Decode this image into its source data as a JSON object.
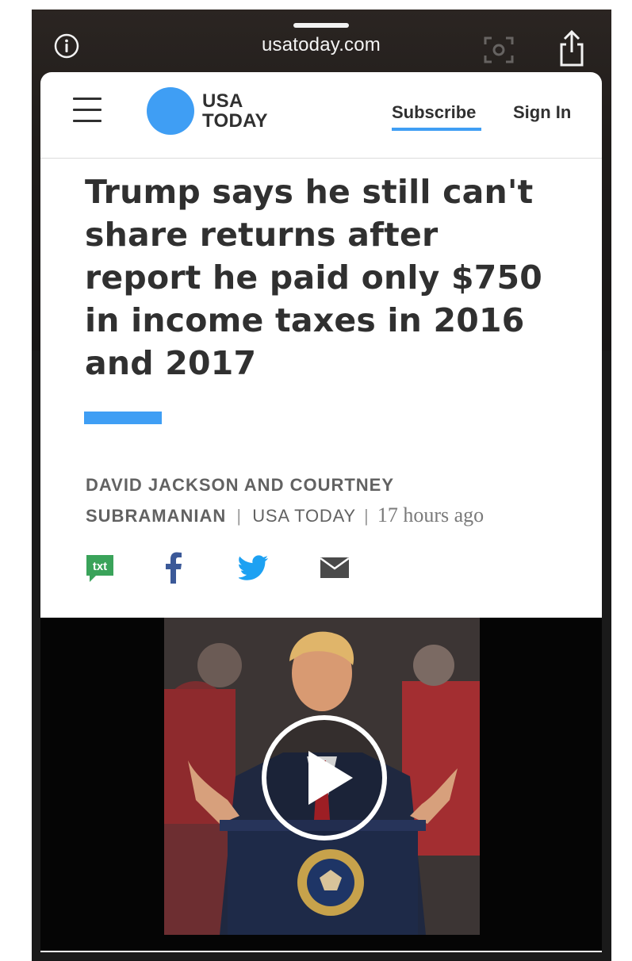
{
  "browser": {
    "url": "usatoday.com",
    "icons": [
      "info-icon",
      "scan-icon",
      "share-icon"
    ]
  },
  "header": {
    "logo_line1": "USA",
    "logo_line2": "TODAY",
    "subscribe_label": "Subscribe",
    "signin_label": "Sign In",
    "accent_color": "#3f9ef4"
  },
  "article": {
    "headline": "Trump says he still can't share returns after report he paid only $750 in income taxes in 2016 and 2017",
    "authors_line1": "DAVID JACKSON AND COURTNEY",
    "authors_line2": "SUBRAMANIAN",
    "source": "USA TODAY",
    "time": "17 hours ago",
    "share_icons": [
      "txt",
      "facebook-icon",
      "twitter-icon",
      "email-icon"
    ],
    "txt_label": "txt"
  },
  "video": {
    "play_icon": "play-icon"
  }
}
